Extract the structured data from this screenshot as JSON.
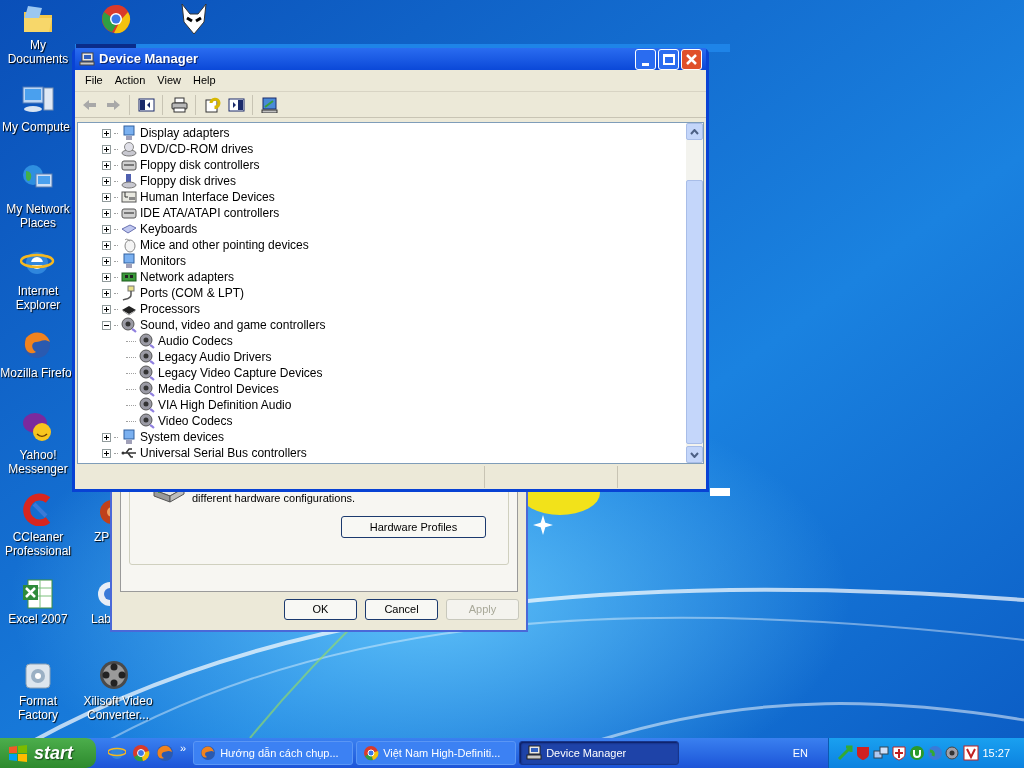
{
  "desktop_icons": [
    {
      "label": "My Documents"
    },
    {
      "label": "My Compute"
    },
    {
      "label": "My Network Places"
    },
    {
      "label": "Internet Explorer"
    },
    {
      "label": "Mozilla Firefo"
    },
    {
      "label": "Yahoo! Messenger"
    },
    {
      "label": "CCleaner Professional"
    },
    {
      "label": "Excel 2007"
    },
    {
      "label": "Format Factory"
    },
    {
      "label": "ZP"
    },
    {
      "label": "Lab"
    },
    {
      "label": "Xilisoft Video Converter..."
    }
  ],
  "properties_dialog": {
    "description": "different hardware configurations.",
    "profiles_button": "Hardware Profiles",
    "buttons": [
      {
        "label": "OK",
        "disabled": false
      },
      {
        "label": "Cancel",
        "disabled": false
      },
      {
        "label": "Apply",
        "disabled": true
      }
    ]
  },
  "window": {
    "title": "Device Manager",
    "menu": [
      "File",
      "Action",
      "View",
      "Help"
    ],
    "toolbar": [
      {
        "kind": "back",
        "disabled": true
      },
      {
        "kind": "forward",
        "disabled": true
      },
      {
        "kind": "sep"
      },
      {
        "kind": "tree",
        "disabled": false
      },
      {
        "kind": "sep"
      },
      {
        "kind": "print",
        "disabled": false
      },
      {
        "kind": "sep"
      },
      {
        "kind": "properties",
        "disabled": false
      },
      {
        "kind": "pane",
        "disabled": false
      },
      {
        "kind": "sep"
      },
      {
        "kind": "scan",
        "disabled": false
      }
    ],
    "tree": [
      {
        "label": "Display adapters",
        "expanded": false
      },
      {
        "label": "DVD/CD-ROM drives",
        "expanded": false
      },
      {
        "label": "Floppy disk controllers",
        "expanded": false
      },
      {
        "label": "Floppy disk drives",
        "expanded": false
      },
      {
        "label": "Human Interface Devices",
        "expanded": false
      },
      {
        "label": "IDE ATA/ATAPI controllers",
        "expanded": false
      },
      {
        "label": "Keyboards",
        "expanded": false
      },
      {
        "label": "Mice and other pointing devices",
        "expanded": false
      },
      {
        "label": "Monitors",
        "expanded": false
      },
      {
        "label": "Network adapters",
        "expanded": false
      },
      {
        "label": "Ports (COM & LPT)",
        "expanded": false
      },
      {
        "label": "Processors",
        "expanded": false
      },
      {
        "label": "Sound, video and game controllers",
        "expanded": true,
        "children": [
          {
            "label": "Audio Codecs"
          },
          {
            "label": "Legacy Audio Drivers"
          },
          {
            "label": "Legacy Video Capture Devices"
          },
          {
            "label": "Media Control Devices"
          },
          {
            "label": "VIA High Definition Audio"
          },
          {
            "label": "Video Codecs"
          }
        ]
      },
      {
        "label": "System devices",
        "expanded": false
      },
      {
        "label": "Universal Serial Bus controllers",
        "expanded": false
      }
    ]
  },
  "taskbar": {
    "start": "start",
    "tasks": [
      {
        "label": "Hướng dẫn cách chụp...",
        "selected": false
      },
      {
        "label": "Việt Nam High-Definiti...",
        "selected": false
      },
      {
        "label": "Device Manager",
        "selected": true
      }
    ],
    "chevron": "»",
    "language": "EN",
    "clock": "15:27"
  }
}
